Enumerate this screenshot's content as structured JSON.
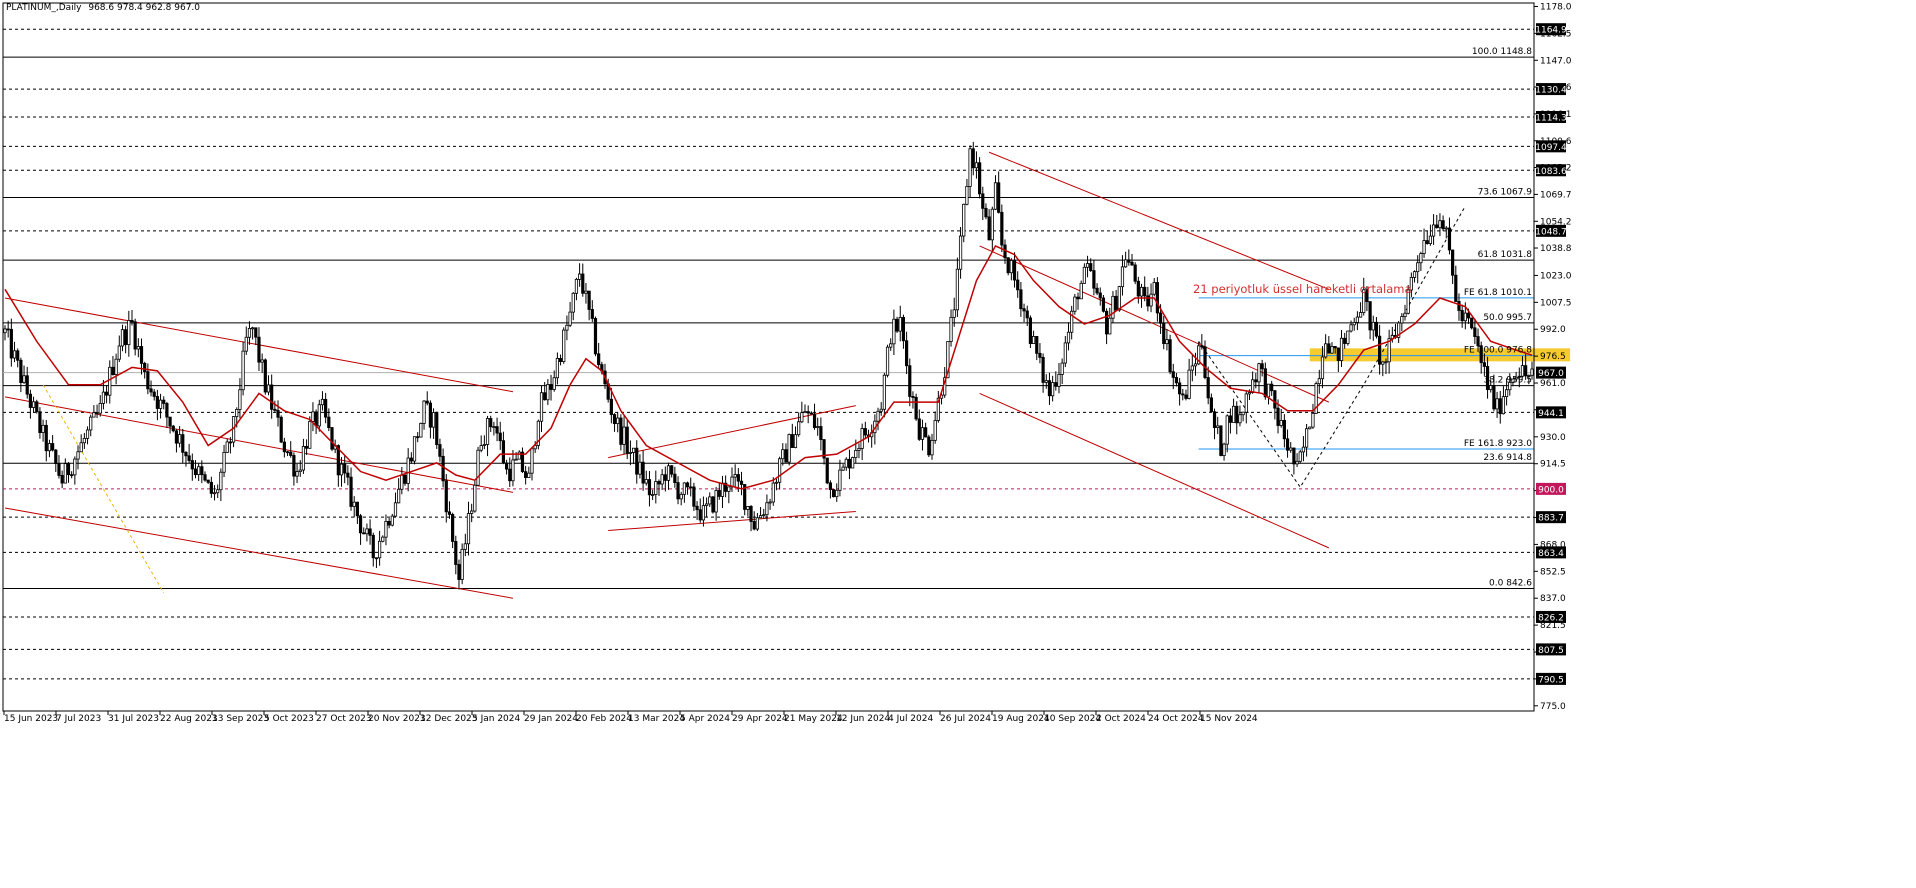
{
  "header": {
    "symbol_label": "PLATINUM_,Daily",
    "ohlc_label": "968.6 978.4 962.8 967.0"
  },
  "annotation": {
    "text": "21 periyotluk üssel hareketli ortalama",
    "color": "#d32f2f"
  },
  "colors": {
    "candle": "#000000",
    "ema": "#c00000",
    "channel": "#c00000",
    "fib_line": "#000000",
    "fe_line": "#2196f3",
    "zone": "#f5c518",
    "level_900": "#c2185b"
  },
  "chart_data": {
    "type": "candlestick",
    "symbol": "PLATINUM_",
    "timeframe": "Daily",
    "last_price": 967.0,
    "ylim": [
      772,
      1180
    ],
    "x_ticks": [
      "15 Jun 2023",
      "7 Jul 2023",
      "31 Jul 2023",
      "22 Aug 2023",
      "13 Sep 2023",
      "5 Oct 2023",
      "27 Oct 2023",
      "20 Nov 2023",
      "12 Dec 2023",
      "5 Jan 2024",
      "29 Jan 2024",
      "20 Feb 2024",
      "13 Mar 2024",
      "5 Apr 2024",
      "29 Apr 2024",
      "21 May 2024",
      "12 Jun 2024",
      "4 Jul 2024",
      "26 Jul 2024",
      "19 Aug 2024",
      "10 Sep 2024",
      "2 Oct 2024",
      "24 Oct 2024",
      "15 Nov 2024"
    ],
    "y_ticks": [
      "1178.0",
      "1162.5",
      "1147.0",
      "1131.6",
      "1116.1",
      "1100.6",
      "1085.2",
      "1069.7",
      "1054.2",
      "1038.8",
      "1023.0",
      "1007.5",
      "992.0",
      "976.5",
      "961.0",
      "945.6",
      "930.0",
      "914.5",
      "899.0",
      "883.5",
      "868.0",
      "852.5",
      "837.0",
      "821.5",
      "806.0",
      "790.5",
      "775.0"
    ],
    "price_boxes": [
      {
        "label": "1164.9",
        "value": 1164.9
      },
      {
        "label": "1130.4",
        "value": 1130.4
      },
      {
        "label": "1114.3",
        "value": 1114.3
      },
      {
        "label": "1097.4",
        "value": 1097.4
      },
      {
        "label": "1083.6",
        "value": 1083.6
      },
      {
        "label": "1048.7",
        "value": 1048.7
      },
      {
        "label": "967.0",
        "value": 967.0
      },
      {
        "label": "944.1",
        "value": 944.1
      },
      {
        "label": "883.7",
        "value": 883.7
      },
      {
        "label": "863.4",
        "value": 863.4
      },
      {
        "label": "826.2",
        "value": 826.2
      },
      {
        "label": "807.5",
        "value": 807.5
      },
      {
        "label": "790.5",
        "value": 790.5
      }
    ],
    "level_900": {
      "label": "900.0",
      "value": 900.0
    },
    "fib_levels": [
      {
        "label": "100.0 1148.8",
        "value": 1148.8
      },
      {
        "label": "73.6 1067.9",
        "value": 1067.9
      },
      {
        "label": "61.8 1031.8",
        "value": 1031.8
      },
      {
        "label": "50.0 995.7",
        "value": 995.7
      },
      {
        "label": "38.2 959.5",
        "value": 959.5
      },
      {
        "label": "23.6 914.8",
        "value": 914.8
      },
      {
        "label": "0.0 842.6",
        "value": 842.6
      }
    ],
    "fe_levels": [
      {
        "label": "FE 61.8 1010.1",
        "value": 1010.1
      },
      {
        "label": "FE 100.0 976.8",
        "value": 976.8
      },
      {
        "label": "FE 161.8 923.0",
        "value": 923.0
      }
    ],
    "support_levels": [
      1164.9,
      1130.4,
      1114.3,
      1097.4,
      1083.6,
      1048.7,
      944.1,
      883.7,
      863.4,
      826.2,
      807.5,
      790.5
    ],
    "zone": {
      "low": 973.5,
      "high": 981.0
    },
    "ema_period": 21,
    "price_path": [
      [
        0,
        990
      ],
      [
        6,
        960
      ],
      [
        12,
        930
      ],
      [
        18,
        905
      ],
      [
        24,
        925
      ],
      [
        30,
        945
      ],
      [
        36,
        985
      ],
      [
        40,
        995
      ],
      [
        44,
        965
      ],
      [
        50,
        945
      ],
      [
        56,
        925
      ],
      [
        62,
        905
      ],
      [
        66,
        895
      ],
      [
        72,
        935
      ],
      [
        76,
        985
      ],
      [
        78,
        992
      ],
      [
        82,
        960
      ],
      [
        88,
        925
      ],
      [
        92,
        910
      ],
      [
        96,
        935
      ],
      [
        100,
        945
      ],
      [
        104,
        920
      ],
      [
        108,
        900
      ],
      [
        112,
        880
      ],
      [
        116,
        862
      ],
      [
        120,
        880
      ],
      [
        124,
        900
      ],
      [
        128,
        920
      ],
      [
        132,
        945
      ],
      [
        135,
        940
      ],
      [
        138,
        905
      ],
      [
        141,
        870
      ],
      [
        143,
        848
      ],
      [
        146,
        880
      ],
      [
        150,
        930
      ],
      [
        154,
        940
      ],
      [
        158,
        910
      ],
      [
        162,
        915
      ],
      [
        165,
        905
      ],
      [
        168,
        945
      ],
      [
        172,
        960
      ],
      [
        175,
        980
      ],
      [
        178,
        1000
      ],
      [
        181,
        1025
      ],
      [
        184,
        1000
      ],
      [
        188,
        965
      ],
      [
        192,
        940
      ],
      [
        196,
        925
      ],
      [
        200,
        910
      ],
      [
        204,
        895
      ],
      [
        208,
        910
      ],
      [
        212,
        900
      ],
      [
        216,
        895
      ],
      [
        220,
        885
      ],
      [
        224,
        895
      ],
      [
        228,
        905
      ],
      [
        232,
        900
      ],
      [
        236,
        880
      ],
      [
        240,
        892
      ],
      [
        244,
        912
      ],
      [
        248,
        930
      ],
      [
        252,
        945
      ],
      [
        256,
        935
      ],
      [
        260,
        900
      ],
      [
        264,
        910
      ],
      [
        268,
        925
      ],
      [
        272,
        935
      ],
      [
        276,
        950
      ],
      [
        279,
        990
      ],
      [
        282,
        995
      ],
      [
        285,
        960
      ],
      [
        288,
        935
      ],
      [
        291,
        925
      ],
      [
        294,
        950
      ],
      [
        297,
        980
      ],
      [
        300,
        1020
      ],
      [
        302,
        1060
      ],
      [
        304,
        1095
      ],
      [
        306,
        1085
      ],
      [
        308,
        1060
      ],
      [
        310,
        1045
      ],
      [
        312,
        1070
      ],
      [
        314,
        1040
      ],
      [
        317,
        1025
      ],
      [
        320,
        1010
      ],
      [
        323,
        990
      ],
      [
        326,
        970
      ],
      [
        329,
        955
      ],
      [
        332,
        970
      ],
      [
        335,
        990
      ],
      [
        338,
        1015
      ],
      [
        341,
        1025
      ],
      [
        344,
        1010
      ],
      [
        347,
        995
      ],
      [
        350,
        1010
      ],
      [
        353,
        1035
      ],
      [
        356,
        1020
      ],
      [
        359,
        1005
      ],
      [
        362,
        1015
      ],
      [
        365,
        990
      ],
      [
        368,
        965
      ],
      [
        371,
        950
      ],
      [
        374,
        970
      ],
      [
        377,
        985
      ],
      [
        380,
        940
      ],
      [
        383,
        925
      ],
      [
        386,
        945
      ],
      [
        389,
        940
      ],
      [
        392,
        960
      ],
      [
        395,
        970
      ],
      [
        398,
        955
      ],
      [
        401,
        940
      ],
      [
        404,
        925
      ],
      [
        407,
        910
      ],
      [
        410,
        930
      ],
      [
        413,
        960
      ],
      [
        416,
        990
      ],
      [
        419,
        975
      ],
      [
        422,
        985
      ],
      [
        425,
        1000
      ],
      [
        428,
        1010
      ],
      [
        431,
        990
      ],
      [
        434,
        970
      ],
      [
        437,
        985
      ],
      [
        440,
        1000
      ],
      [
        443,
        1020
      ],
      [
        446,
        1040
      ],
      [
        449,
        1050
      ],
      [
        452,
        1060
      ],
      [
        455,
        1035
      ],
      [
        458,
        1000
      ],
      [
        461,
        995
      ],
      [
        464,
        980
      ],
      [
        467,
        960
      ],
      [
        470,
        945
      ],
      [
        473,
        960
      ],
      [
        476,
        970
      ],
      [
        479,
        965
      ],
      [
        481,
        967
      ]
    ],
    "ema_points": [
      [
        0,
        1015
      ],
      [
        10,
        985
      ],
      [
        20,
        960
      ],
      [
        30,
        960
      ],
      [
        40,
        970
      ],
      [
        48,
        968
      ],
      [
        56,
        950
      ],
      [
        64,
        925
      ],
      [
        72,
        935
      ],
      [
        80,
        955
      ],
      [
        88,
        945
      ],
      [
        96,
        940
      ],
      [
        104,
        925
      ],
      [
        112,
        910
      ],
      [
        120,
        905
      ],
      [
        128,
        910
      ],
      [
        136,
        915
      ],
      [
        142,
        908
      ],
      [
        148,
        905
      ],
      [
        156,
        920
      ],
      [
        164,
        920
      ],
      [
        172,
        935
      ],
      [
        178,
        960
      ],
      [
        183,
        975
      ],
      [
        188,
        968
      ],
      [
        194,
        945
      ],
      [
        202,
        925
      ],
      [
        212,
        915
      ],
      [
        222,
        905
      ],
      [
        232,
        900
      ],
      [
        242,
        905
      ],
      [
        252,
        918
      ],
      [
        262,
        920
      ],
      [
        272,
        930
      ],
      [
        280,
        950
      ],
      [
        288,
        950
      ],
      [
        294,
        950
      ],
      [
        300,
        985
      ],
      [
        306,
        1020
      ],
      [
        312,
        1040
      ],
      [
        318,
        1035
      ],
      [
        324,
        1020
      ],
      [
        332,
        1005
      ],
      [
        340,
        995
      ],
      [
        348,
        1000
      ],
      [
        356,
        1010
      ],
      [
        362,
        1010
      ],
      [
        370,
        985
      ],
      [
        378,
        970
      ],
      [
        386,
        958
      ],
      [
        396,
        955
      ],
      [
        404,
        945
      ],
      [
        412,
        945
      ],
      [
        420,
        960
      ],
      [
        428,
        980
      ],
      [
        436,
        985
      ],
      [
        444,
        995
      ],
      [
        452,
        1010
      ],
      [
        460,
        1005
      ],
      [
        468,
        985
      ],
      [
        476,
        980
      ],
      [
        481,
        977
      ]
    ],
    "channel_lines": [
      {
        "p1": [
          0,
          1010
        ],
        "p2": [
          160,
          956
        ]
      },
      {
        "p1": [
          0,
          953
        ],
        "p2": [
          160,
          898
        ]
      },
      {
        "p1": [
          0,
          889
        ],
        "p2": [
          160,
          837
        ]
      },
      {
        "p1": [
          190,
          918
        ],
        "p2": [
          268,
          948
        ]
      },
      {
        "p1": [
          190,
          876
        ],
        "p2": [
          268,
          887
        ]
      },
      {
        "p1": [
          310,
          1094
        ],
        "p2": [
          417,
          1015
        ]
      },
      {
        "p1": [
          307,
          1040
        ],
        "p2": [
          417,
          950
        ]
      },
      {
        "p1": [
          307,
          955
        ],
        "p2": [
          417,
          866
        ]
      }
    ],
    "zigzag": [
      [
        376,
        985
      ],
      [
        408,
        901
      ],
      [
        428,
        960
      ],
      [
        460,
        1063
      ]
    ],
    "fe_range": [
      376,
      497
    ],
    "zone_range": [
      411,
      493
    ]
  }
}
